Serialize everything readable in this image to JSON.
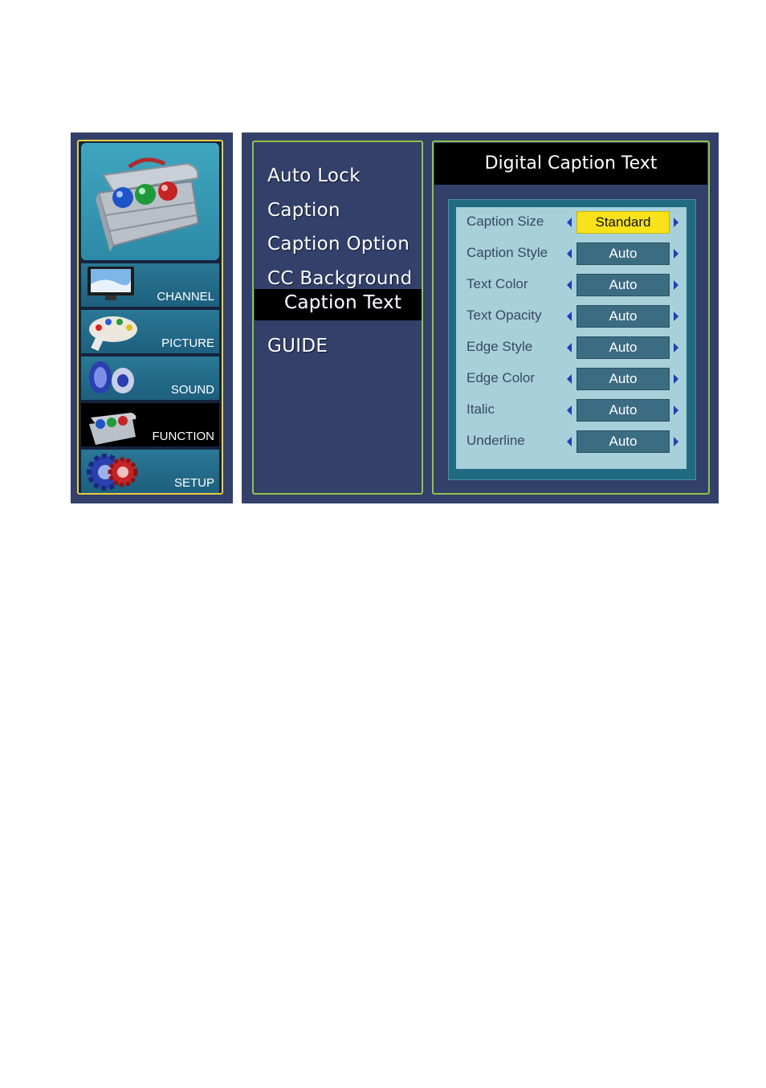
{
  "categories": [
    {
      "label": "CHANNEL",
      "icon": "tv-icon",
      "active": false
    },
    {
      "label": "PICTURE",
      "icon": "palette-icon",
      "active": false
    },
    {
      "label": "SOUND",
      "icon": "speaker-icon",
      "active": false
    },
    {
      "label": "FUNCTION",
      "icon": "toolbox-icon",
      "active": true
    },
    {
      "label": "SETUP",
      "icon": "gear-icon",
      "active": false
    }
  ],
  "menu": {
    "items": [
      "Auto Lock",
      "Caption",
      "Caption Option",
      "CC Background",
      "Caption Text",
      "GUIDE"
    ],
    "selected": "Caption Text"
  },
  "detail": {
    "title": "Digital Caption Text",
    "settings": [
      {
        "label": "Caption Size",
        "value": "Standard"
      },
      {
        "label": "Caption Style",
        "value": "Auto"
      },
      {
        "label": "Text Color",
        "value": "Auto"
      },
      {
        "label": "Text Opacity",
        "value": "Auto"
      },
      {
        "label": "Edge Style",
        "value": "Auto"
      },
      {
        "label": "Edge Color",
        "value": "Auto"
      },
      {
        "label": "Italic",
        "value": "Auto"
      },
      {
        "label": "Underline",
        "value": "Auto"
      }
    ]
  },
  "colors": {
    "panel_bg": "#33406a",
    "selected_value": "#f7e21b",
    "frame_border": "#8fc24b",
    "category_frame": "#e8cf3c"
  }
}
